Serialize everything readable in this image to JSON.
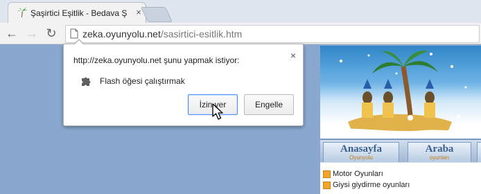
{
  "tab": {
    "title": "Şaşirtici Eşitlik - Bedava Ş",
    "close": "×"
  },
  "toolbar": {
    "back": "←",
    "forward": "→",
    "reload": "↻",
    "url_host": "zeka.oyunyolu.net",
    "url_path": "/sasirtici-esitlik.htm"
  },
  "dialog": {
    "prompt": "http://zeka.oyunyolu.net şunu yapmak istiyor:",
    "close": "×",
    "permission": "Flash öğesi çalıştırmak",
    "allow_label": "İzin ver",
    "block_label": "Engelle"
  },
  "site": {
    "nav": [
      {
        "main": "Anasayfa",
        "sub": "Oyunyolu"
      },
      {
        "main": "Araba",
        "sub": "oyunları"
      }
    ],
    "menu": [
      "Motor Oyunları",
      "Giysi giydirme oyunları"
    ]
  },
  "icons": {
    "favicon": "palm-tree-icon",
    "page": "page-icon",
    "permission": "puzzle-piece-icon",
    "cursor": "mouse-pointer-icon"
  },
  "colors": {
    "page_background": "#8aa8cf",
    "allow_button_border": "#4d90fe",
    "menu_bullet": "#f1a52a"
  }
}
